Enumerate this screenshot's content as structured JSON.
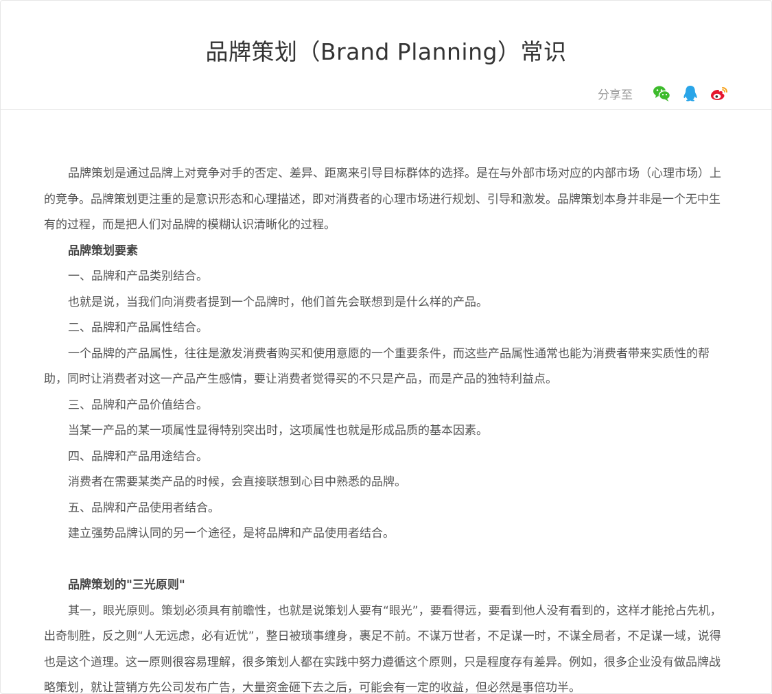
{
  "article": {
    "title": "品牌策划（Brand Planning）常识",
    "share_label": "分享至",
    "share_icons": [
      "wechat-icon",
      "qq-icon",
      "weibo-icon"
    ],
    "paragraphs": [
      "品牌策划是通过品牌上对竞争对手的否定、差异、距离来引导目标群体的选择。是在与外部市场对应的内部市场（心理市场）上的竞争。品牌策划更注重的是意识形态和心理描述，即对消费者的心理市场进行规划、引导和激发。品牌策划本身并非是一个无中生有的过程，而是把人们对品牌的模糊认识清晰化的过程。",
      "品牌策划要素",
      "一、品牌和产品类别结合。",
      "也就是说，当我们向消费者提到一个品牌时，他们首先会联想到是什么样的产品。",
      "二、品牌和产品属性结合。",
      "一个品牌的产品属性，往往是激发消费者购买和使用意愿的一个重要条件，而这些产品属性通常也能为消费者带来实质性的帮助，同时让消费者对这一产品产生感情，要让消费者觉得买的不只是产品，而是产品的独特利益点。",
      "三、品牌和产品价值结合。",
      "当某一产品的某一项属性显得特别突出时，这项属性也就是形成品质的基本因素。",
      "四、品牌和产品用途结合。",
      "消费者在需要某类产品的时候，会直接联想到心目中熟悉的品牌。",
      "五、品牌和产品使用者结合。",
      "建立强势品牌认同的另一个途径，是将品牌和产品使用者结合。",
      "品牌策划的\"三光原则\"",
      "其一，眼光原则。策划必须具有前瞻性，也就是说策划人要有“眼光”，要看得远，要看到他人没有看到的，这样才能抢占先机，出奇制胜，反之则“人无远虑，必有近忧”，整日被琐事缠身，裹足不前。不谋万世者，不足谋一时，不谋全局者，不足谋一域，说得也是这个道理。这一原则很容易理解，很多策划人都在实践中努力遵循这个原则，只是程度存有差异。例如，很多企业没有做品牌战略策划，就让营销方先公司发布广告，大量资金砸下去之后，可能会有一定的收益，但必然是事倍功半。"
    ]
  },
  "colors": {
    "title": "#333333",
    "body_text": "#555555",
    "share_label": "#999999",
    "wechat": "#3dbb2c",
    "qq": "#2aa5e8",
    "weibo": "#e6162d",
    "weibo_eye": "#f7a21b"
  }
}
